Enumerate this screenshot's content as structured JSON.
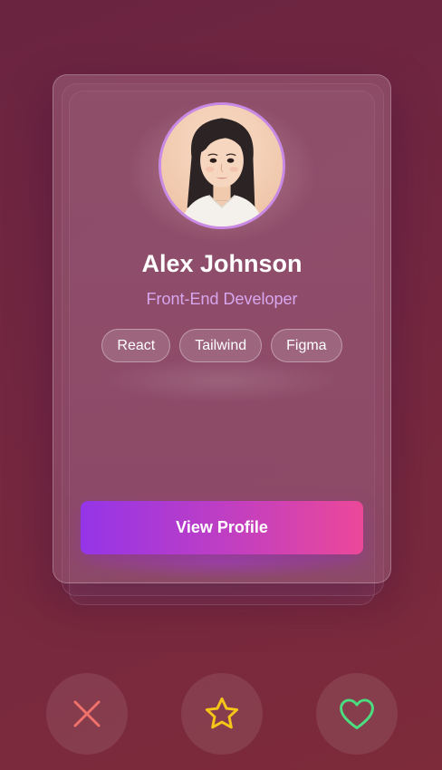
{
  "profile": {
    "name": "Alex Johnson",
    "role": "Front-End Developer",
    "skills": [
      "React",
      "Tailwind",
      "Figma"
    ]
  },
  "card": {
    "button_label": "View Profile"
  },
  "actions": {
    "reject_icon": "close-icon",
    "favorite_icon": "star-icon",
    "like_icon": "heart-icon"
  },
  "colors": {
    "background": "#742740",
    "accent_role": "#d7a6ee",
    "avatar_ring": "#c98ae6",
    "button_gradient_start": "#9535e8",
    "button_gradient_end": "#ec4899",
    "reject": "#f0706a",
    "star": "#f5c518",
    "like": "#4ade80"
  }
}
